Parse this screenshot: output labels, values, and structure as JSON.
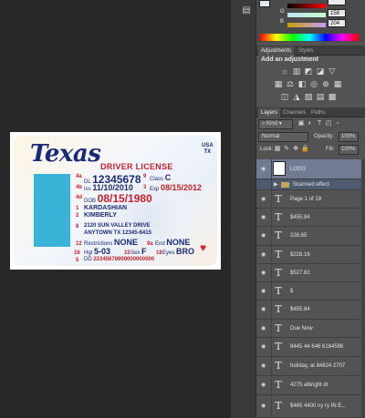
{
  "canvas": {
    "license": {
      "state_name": "Texas",
      "heading": "DRIVER LICENSE",
      "country": [
        "USA",
        "TX"
      ],
      "dl_label": "DL",
      "dl_number": "12345678",
      "class_label": "Class",
      "class_value": "C",
      "iss_label": "Iss",
      "iss_date": "11/10/2010",
      "exp_label": "Exp",
      "exp_date": "08/15/2012",
      "dob_label": "DOB",
      "dob_date": "08/15/1980",
      "last_name": "KARDASHIAN",
      "first_name": "KIMBERLY",
      "address_1": "2120 SUN VALLEY DRIVE",
      "address_2": "ANYTOWN    TX 12345-6415",
      "restrictions_label": "Restrictions",
      "restrictions_value": "NONE",
      "end_label": "End",
      "end_value": "NONE",
      "hgt_label": "Hgt",
      "hgt_value": "5-03",
      "sex_label": "Sex",
      "sex_value": "F",
      "eyes_label": "Eyes",
      "eyes_value": "BRO",
      "dd_label": "DD",
      "dd_value": "22345678900000000000",
      "field_numbers": [
        "4a",
        "4b",
        "4d",
        "9",
        "3",
        "1",
        "2",
        "8",
        "12",
        "9a",
        "4c",
        "16",
        "15",
        "18",
        "5"
      ],
      "photo_color": "#3ab3d9"
    }
  },
  "color_panel": {
    "sliders": [
      {
        "letter": "",
        "value": ""
      },
      {
        "letter": "G",
        "value": "158"
      },
      {
        "letter": "B",
        "value": "204"
      }
    ]
  },
  "adjustments": {
    "tabs": [
      "Adjustments",
      "Styles"
    ],
    "title": "Add an adjustment"
  },
  "layers_panel": {
    "tabs": [
      "Layers",
      "Channels",
      "Paths"
    ],
    "kind_label": "Kind",
    "blend_mode": "Normal",
    "opacity_label": "Opacity:",
    "opacity_value": "100%",
    "lock_label": "Lock:",
    "fill_label": "Fill:",
    "fill_value": "100%",
    "layers": [
      {
        "name": "LOGO",
        "type": "image",
        "selected": true
      },
      {
        "name": "Scanned effect",
        "type": "folder",
        "selected": true
      },
      {
        "name": "Page 1 of 19",
        "type": "text"
      },
      {
        "name": "$455.84",
        "type": "text"
      },
      {
        "name": "228.65",
        "type": "text"
      },
      {
        "name": "$228.16",
        "type": "text"
      },
      {
        "name": "$527.82",
        "type": "text"
      },
      {
        "name": "$",
        "type": "text"
      },
      {
        "name": "$455.84",
        "type": "text"
      },
      {
        "name": "Due Now",
        "type": "text"
      },
      {
        "name": "8445 44 646 6164596",
        "type": "text"
      },
      {
        "name": "holiday, at 84624 2707",
        "type": "text"
      },
      {
        "name": "4275 albright dr",
        "type": "text"
      },
      {
        "name": "$465 4400  ny ry IN E...",
        "type": "text"
      }
    ]
  },
  "colors": {
    "accent_red": "#c8202a",
    "license_blue": "#1a2a78",
    "selected_layer": "#6f7c93",
    "panel_bg": "#535353"
  }
}
